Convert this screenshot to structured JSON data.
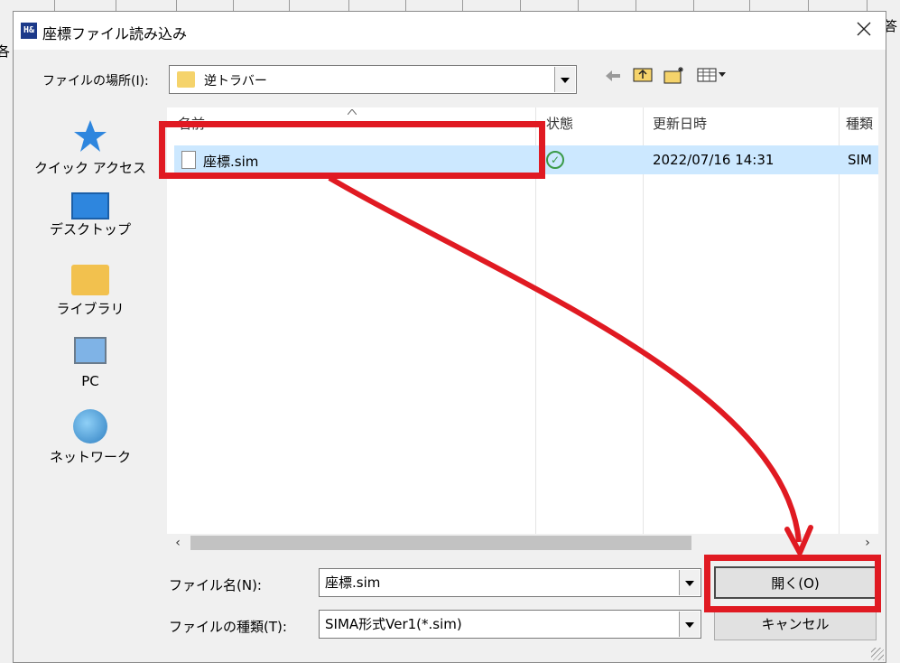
{
  "dialog": {
    "title": "座標ファイル読み込み",
    "app_icon_text": "H&"
  },
  "background": {
    "left_char": "各",
    "right_char": "答"
  },
  "look_in": {
    "label": "ファイルの場所(I):",
    "value": "逆トラバー"
  },
  "toolbar": {
    "back_icon": "back-arrow-icon",
    "up_icon": "up-folder-icon",
    "new_folder_icon": "new-folder-icon",
    "view_icon": "view-menu-icon"
  },
  "places": [
    {
      "label": "クイック アクセス",
      "icon": "star-icon"
    },
    {
      "label": "デスクトップ",
      "icon": "desktop-icon"
    },
    {
      "label": "ライブラリ",
      "icon": "library-icon"
    },
    {
      "label": "PC",
      "icon": "pc-icon"
    },
    {
      "label": "ネットワーク",
      "icon": "network-icon"
    }
  ],
  "file_list": {
    "columns": [
      "名前",
      "状態",
      "更新日時",
      "種類"
    ],
    "rows": [
      {
        "name": "座標.sim",
        "status": "✓",
        "modified": "2022/07/16 14:31",
        "type": "SIM"
      }
    ]
  },
  "file_name": {
    "label": "ファイル名(N):",
    "value": "座標.sim"
  },
  "file_type": {
    "label": "ファイルの種類(T):",
    "value": "SIMA形式Ver1(*.sim)"
  },
  "buttons": {
    "open": "開く(O)",
    "cancel": "キャンセル"
  },
  "annotation_color": "#e01a22"
}
